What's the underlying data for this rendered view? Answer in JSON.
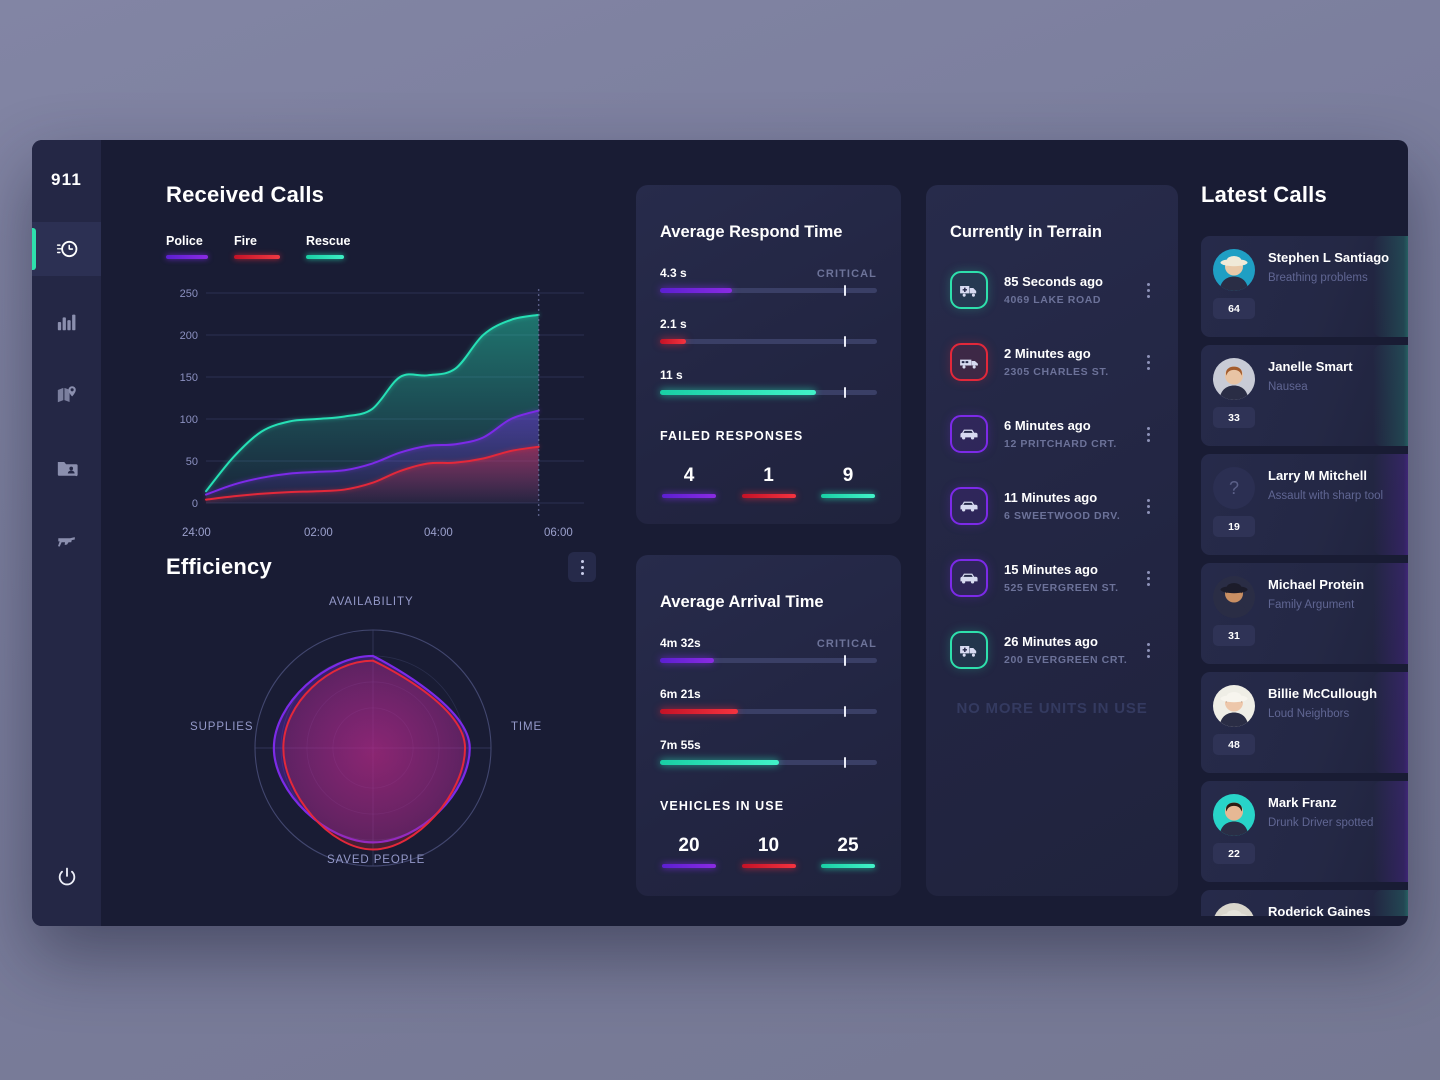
{
  "app": {
    "logo": "911"
  },
  "sidebar": {
    "items": [
      {
        "name": "history-clock-icon",
        "label": "Activity",
        "active": true
      },
      {
        "name": "bar-chart-icon",
        "label": "Statistics",
        "active": false
      },
      {
        "name": "map-pin-icon",
        "label": "Map",
        "active": false
      },
      {
        "name": "contacts-folder-icon",
        "label": "Records",
        "active": false
      },
      {
        "name": "gun-icon",
        "label": "Weapons",
        "active": false
      }
    ],
    "power_label": "Power"
  },
  "received_calls": {
    "title": "Received Calls",
    "legend": [
      {
        "label": "Police",
        "color": "#7c2ae8"
      },
      {
        "label": "Fire",
        "color": "#e3283a"
      },
      {
        "label": "Rescue",
        "color": "#26e0b5"
      }
    ]
  },
  "chart_data": {
    "type": "area",
    "title": "Received Calls",
    "xlabel": "",
    "ylabel": "",
    "x": [
      "24:00",
      "02:00",
      "04:00",
      "06:00"
    ],
    "xticks": [
      "24:00",
      "02:00",
      "04:00",
      "06:00"
    ],
    "yticks": [
      0,
      50,
      100,
      150,
      200,
      250
    ],
    "ylim": [
      0,
      250
    ],
    "grid": true,
    "legend_position": "top-left",
    "series": [
      {
        "name": "Rescue",
        "color": "#26e0b5",
        "values": [
          14,
          55,
          85,
          97,
          100,
          103,
          112,
          150,
          152,
          160,
          200,
          218,
          224
        ]
      },
      {
        "name": "Police",
        "color": "#7c2ae8",
        "values": [
          10,
          22,
          30,
          35,
          37,
          39,
          47,
          60,
          68,
          70,
          78,
          100,
          110
        ]
      },
      {
        "name": "Fire",
        "color": "#e3283a",
        "values": [
          4,
          8,
          11,
          13,
          14,
          16,
          24,
          38,
          47,
          48,
          53,
          62,
          67
        ]
      }
    ]
  },
  "efficiency": {
    "title": "Efficiency",
    "menu_label": "More options",
    "axes": [
      "AVAILABILITY",
      "TIME",
      "SAVED PEOPLE",
      "SUPPLIES"
    ],
    "radar_series": [
      {
        "name": "Police",
        "color": "#7c2ae8",
        "values": [
          78,
          82,
          80,
          84
        ]
      },
      {
        "name": "Fire",
        "color": "#e3283a",
        "values": [
          74,
          78,
          86,
          76
        ]
      }
    ]
  },
  "respond": {
    "title": "Average Respond Time",
    "critical_label": "CRITICAL",
    "metrics": [
      {
        "value": "4.3 s",
        "series": "police",
        "fill_pct": 33,
        "tick_pct": 85
      },
      {
        "value": "2.1 s",
        "series": "fire",
        "fill_pct": 12,
        "tick_pct": 85
      },
      {
        "value": "11 s",
        "series": "rescue",
        "fill_pct": 72,
        "tick_pct": 85
      }
    ],
    "section_label": "FAILED RESPONSES",
    "stats": [
      {
        "number": "4",
        "series": "police"
      },
      {
        "number": "1",
        "series": "fire"
      },
      {
        "number": "9",
        "series": "rescue"
      }
    ]
  },
  "arrival": {
    "title": "Average Arrival Time",
    "critical_label": "CRITICAL",
    "metrics": [
      {
        "value": "4m 32s",
        "series": "police",
        "fill_pct": 25,
        "tick_pct": 85
      },
      {
        "value": "6m 21s",
        "series": "fire",
        "fill_pct": 36,
        "tick_pct": 85
      },
      {
        "value": "7m 55s",
        "series": "rescue",
        "fill_pct": 55,
        "tick_pct": 85
      }
    ],
    "section_label": "VEHICLES IN USE",
    "stats": [
      {
        "number": "20",
        "series": "police"
      },
      {
        "number": "10",
        "series": "fire"
      },
      {
        "number": "25",
        "series": "rescue"
      }
    ]
  },
  "terrain": {
    "title": "Currently in Terrain",
    "empty_label": "NO MORE UNITS IN USE",
    "units": [
      {
        "time": "85 Seconds ago",
        "address": "4069 LAKE ROAD",
        "type": "rescue",
        "icon": "ambulance-icon"
      },
      {
        "time": "2 Minutes ago",
        "address": "2305 CHARLES ST.",
        "type": "fire",
        "icon": "firetruck-icon"
      },
      {
        "time": "6 Minutes ago",
        "address": "12 PRITCHARD CRT.",
        "type": "police",
        "icon": "police-car-icon"
      },
      {
        "time": "11 Minutes ago",
        "address": "6 SWEETWOOD DRV.",
        "type": "police",
        "icon": "police-car-icon"
      },
      {
        "time": "15 Minutes ago",
        "address": "525 EVERGREEN ST.",
        "type": "police",
        "icon": "police-car-icon"
      },
      {
        "time": "26 Minutes ago",
        "address": "200 EVERGREEN CRT.",
        "type": "rescue",
        "icon": "ambulance-icon"
      }
    ]
  },
  "latest_calls": {
    "title": "Latest Calls",
    "calls": [
      {
        "name": "Stephen L Santiago",
        "reason": "Breathing problems",
        "age": "64",
        "accent": "teal",
        "avatar": "photo"
      },
      {
        "name": "Janelle Smart",
        "reason": "Nausea",
        "age": "33",
        "accent": "teal",
        "avatar": "photo"
      },
      {
        "name": "Larry M Mitchell",
        "reason": "Assault with sharp tool",
        "age": "19",
        "accent": "purple",
        "avatar": "unknown"
      },
      {
        "name": "Michael Protein",
        "reason": "Family Argument",
        "age": "31",
        "accent": "purple",
        "avatar": "photo"
      },
      {
        "name": "Billie McCullough",
        "reason": "Loud Neighbors",
        "age": "48",
        "accent": "purple",
        "avatar": "photo"
      },
      {
        "name": "Mark Franz",
        "reason": "Drunk Driver spotted",
        "age": "22",
        "accent": "purple",
        "avatar": "photo"
      },
      {
        "name": "Roderick Gaines",
        "reason": "",
        "age": "",
        "accent": "teal",
        "avatar": "photo"
      }
    ]
  },
  "colors": {
    "police": "#7c2ae8",
    "fire": "#e3283a",
    "rescue": "#26e0b5",
    "background": "#191c34",
    "card": "#252949"
  }
}
